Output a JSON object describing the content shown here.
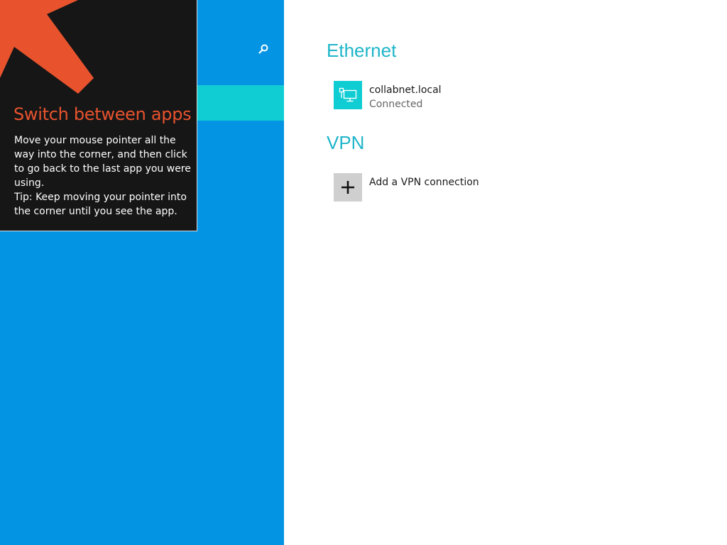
{
  "colors": {
    "left_pane": "#0394e3",
    "selected_tile": "#0fcdd3",
    "tip_background": "#161616",
    "tip_accent": "#e8532e",
    "section_title": "#1fb5c9",
    "ethernet_tile": "#0fcdd3",
    "vpn_tile": "#cfcfcf"
  },
  "left_pane": {
    "search_icon": "search-icon"
  },
  "tip": {
    "arrow_icon": "arrow-up-left-icon",
    "title": "Switch between apps",
    "body_line1": "Move your mouse pointer all the way into the corner, and then click to go back to the last app you were using.",
    "body_line2": "Tip: Keep moving your pointer into the corner until you see the app."
  },
  "ethernet": {
    "section_title": "Ethernet",
    "icon": "ethernet-network-icon",
    "network_name": "collabnet.local",
    "status": "Connected"
  },
  "vpn": {
    "section_title": "VPN",
    "icon": "plus-icon",
    "add_label": "Add a VPN connection"
  }
}
